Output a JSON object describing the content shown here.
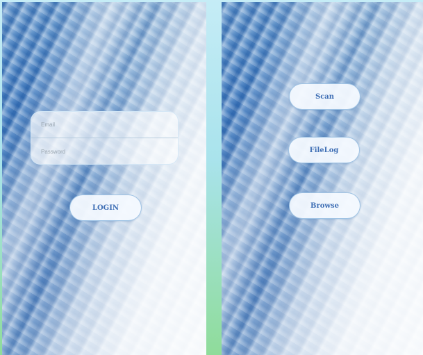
{
  "login_screen": {
    "email_placeholder": "Email",
    "password_placeholder": "Password",
    "login_label": "LOGIN"
  },
  "menu_screen": {
    "scan_label": "Scan",
    "filelog_label": "FileLog",
    "browse_label": "Browse"
  },
  "colors": {
    "button_text": "#3f6fb5",
    "background_top": "#c5ecf6",
    "background_bottom": "#8fdc9a"
  }
}
